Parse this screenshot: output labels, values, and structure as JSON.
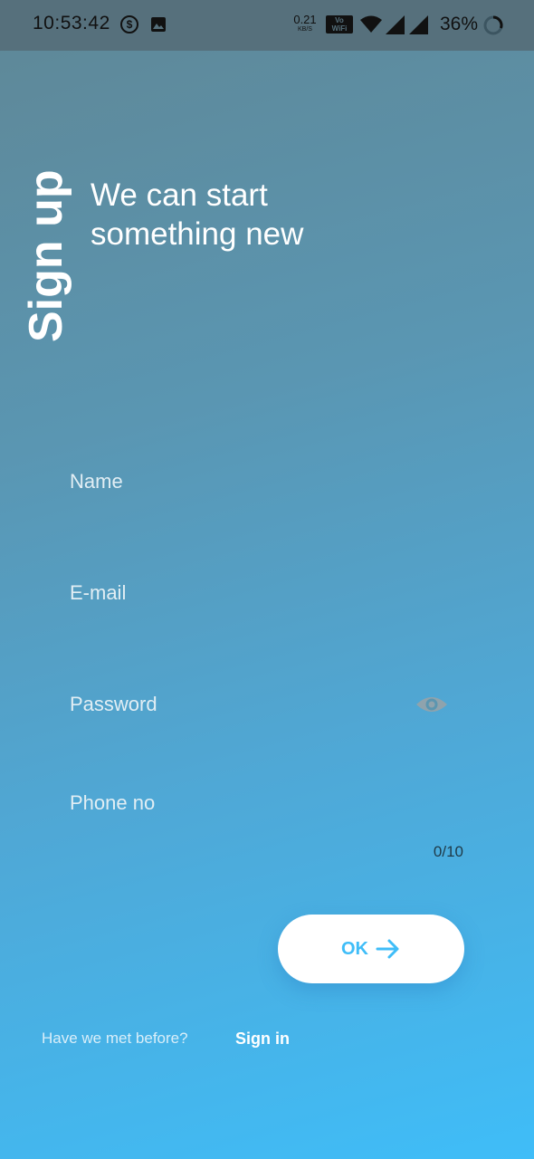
{
  "status_bar": {
    "time": "10:53:42",
    "dollar_icon_glyph": "$",
    "network_speed_value": "0.21",
    "network_speed_unit": "KB/S",
    "volte_line1": "Vo",
    "volte_line2": "WiFi",
    "battery_percent": "36%",
    "icons": [
      "dollar-circle-icon",
      "image-icon",
      "volte-wifi-icon",
      "wifi-icon",
      "signal-icon",
      "signal-icon",
      "battery-ring-icon"
    ]
  },
  "header": {
    "title": "Sign up",
    "tagline_line1": "We can start",
    "tagline_line2": "something new"
  },
  "form": {
    "name_placeholder": "Name",
    "email_placeholder": "E-mail",
    "password_placeholder": "Password",
    "phone_placeholder": "Phone no",
    "phone_counter": "0/10",
    "password_toggle_icon": "eye-icon"
  },
  "actions": {
    "ok_label": "OK",
    "ok_icon": "arrow-right-icon"
  },
  "footer": {
    "prompt": "Have we met before?",
    "sign_in_label": "Sign in"
  },
  "colors": {
    "accent": "#3fbdf8",
    "status_bar_bg": "#56707c",
    "gradient_top": "#5f8796",
    "gradient_bottom": "#3fbdf8"
  }
}
